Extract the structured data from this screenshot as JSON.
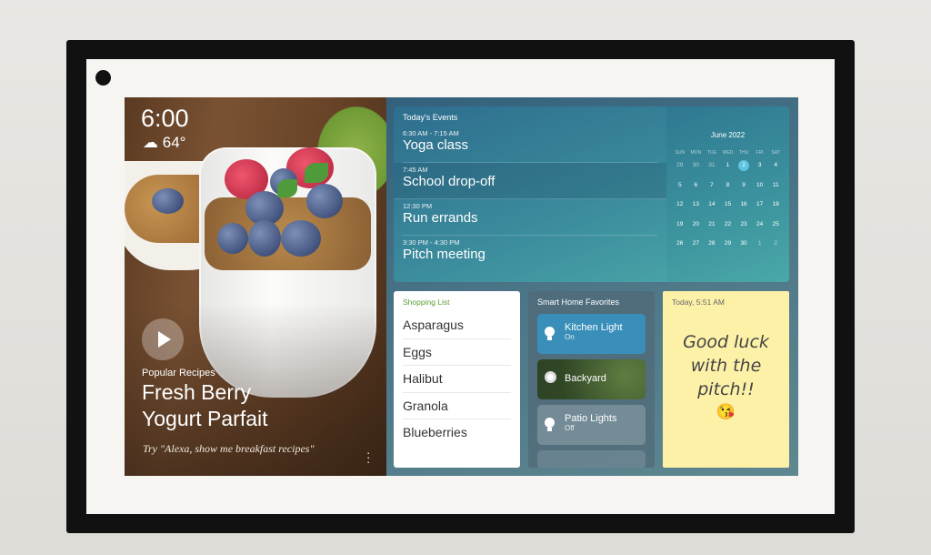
{
  "clock": {
    "time": "6:00",
    "temperature": "64°",
    "weather_icon": "partly-cloudy-icon"
  },
  "recipe": {
    "category": "Popular Recipes",
    "title_line1": "Fresh Berry",
    "title_line2": "Yogurt Parfait",
    "hint": "Try \"Alexa, show me breakfast recipes\""
  },
  "events": {
    "title": "Today's Events",
    "items": [
      {
        "time": "6:30 AM - 7:15 AM",
        "name": "Yoga class"
      },
      {
        "time": "7:45 AM",
        "name": "School drop-off"
      },
      {
        "time": "12:30 PM",
        "name": "Run errands"
      },
      {
        "time": "3:30 PM - 4:30 PM",
        "name": "Pitch meeting"
      }
    ]
  },
  "calendar": {
    "month": "June 2022",
    "weekdays": [
      "SUN",
      "MON",
      "TUE",
      "WED",
      "THU",
      "FRI",
      "SAT"
    ],
    "weeks": [
      [
        "29",
        "30",
        "31",
        "1",
        "2",
        "3",
        "4"
      ],
      [
        "5",
        "6",
        "7",
        "8",
        "9",
        "10",
        "11"
      ],
      [
        "12",
        "13",
        "14",
        "15",
        "16",
        "17",
        "18"
      ],
      [
        "19",
        "20",
        "21",
        "22",
        "23",
        "24",
        "25"
      ],
      [
        "26",
        "27",
        "28",
        "29",
        "30",
        "1",
        "2"
      ]
    ],
    "today": "2",
    "accent": "#5ec4e2"
  },
  "shopping": {
    "title": "Shopping List",
    "items": [
      "Asparagus",
      "Eggs",
      "Halibut",
      "Granola",
      "Blueberries"
    ]
  },
  "smart_home": {
    "title": "Smart Home Favorites",
    "devices": [
      {
        "name": "Kitchen Light",
        "status": "On",
        "icon": "light-bulb-icon"
      },
      {
        "name": "Backyard",
        "icon": "camera-icon"
      },
      {
        "name": "Patio Lights",
        "status": "Off",
        "icon": "light-bulb-icon"
      }
    ]
  },
  "note": {
    "timestamp": "Today, 5:51 AM",
    "line1": "Good luck",
    "line2": "with the",
    "line3": "pitch!!",
    "emoji": "😘"
  }
}
